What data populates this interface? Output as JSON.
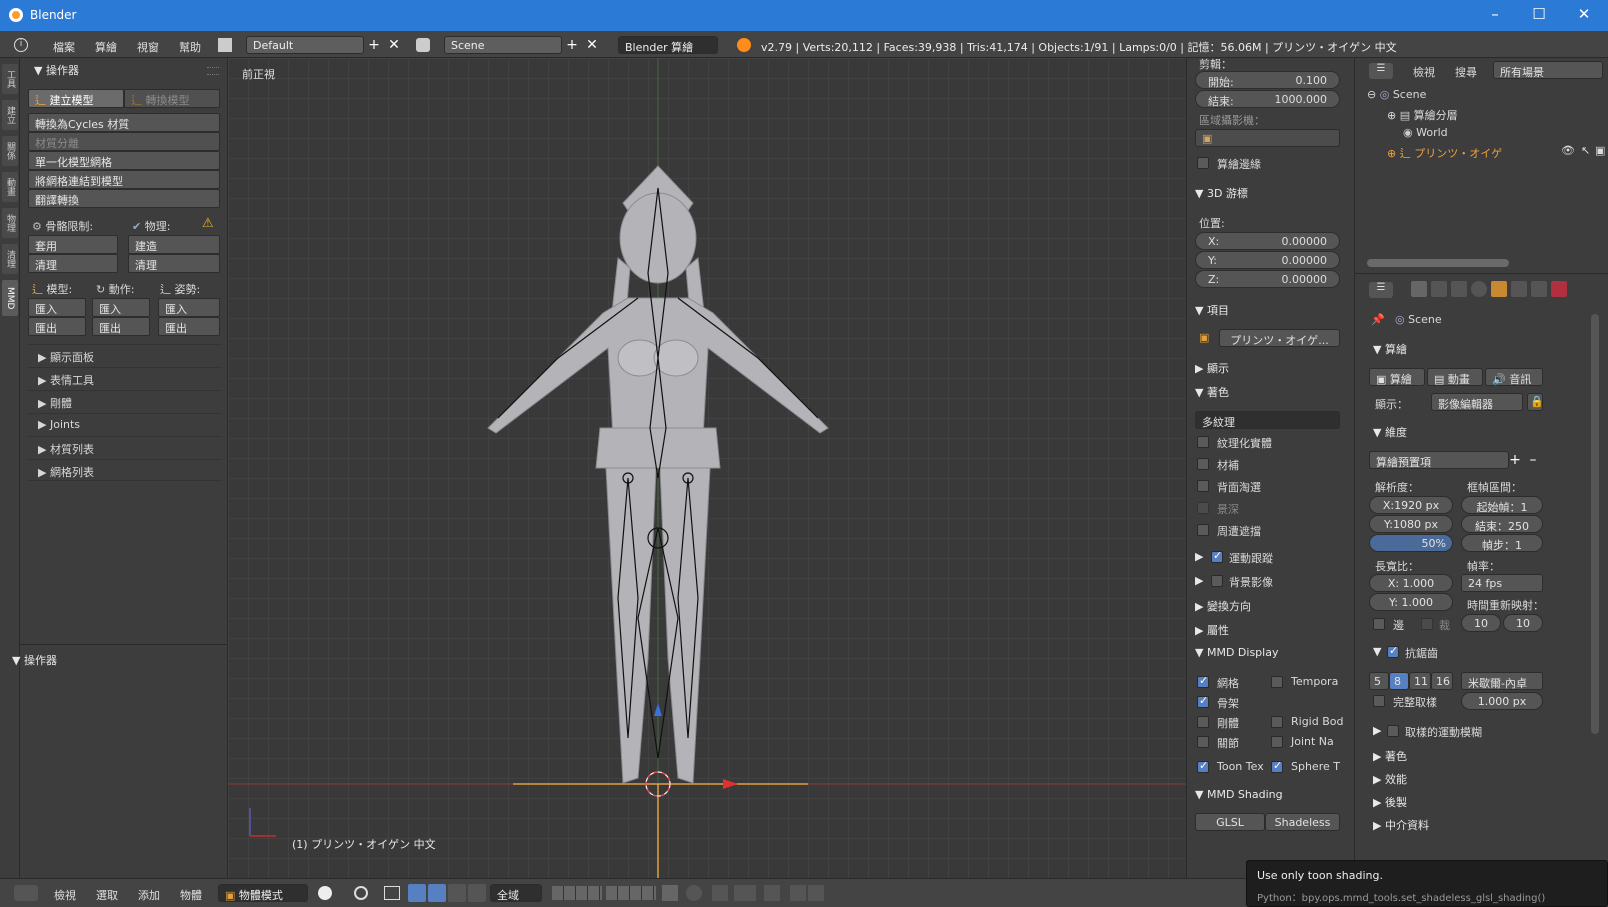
{
  "window": {
    "title": "Blender"
  },
  "menubar": {
    "menus": [
      "檔案",
      "算繪",
      "視窗",
      "幫助"
    ],
    "screen_layout": "Default",
    "scene": "Scene",
    "engine": "Blender 算繪",
    "info": "v2.79 | Verts:20,112 | Faces:39,938 | Tris:41,174 | Objects:1/91 | Lamps:0/0 | 記憶：56.06M | プリンツ・オイゲン 中文"
  },
  "vtabs": [
    "工具",
    "建立",
    "關係",
    "動畫",
    "物理",
    "清理",
    "MMD"
  ],
  "toolshelf": {
    "header": "操作器",
    "tab_create": "建立模型",
    "tab_convert": "轉換模型",
    "buttons": [
      "轉換為Cycles 材質",
      "材質分離",
      "單一化模型網格",
      "將網格連結到模型",
      "翻譯轉換"
    ],
    "bone_label": "骨骼限制:",
    "physics_label": "物理:",
    "apply": "套用",
    "build": "建造",
    "clear": "清理",
    "model_label": "模型:",
    "action_label": "動作:",
    "pose_label": "姿勢:",
    "import": "匯入",
    "export": "匯出",
    "panels": [
      "顯示面板",
      "表情工具",
      "剛體",
      "Joints",
      "材質列表",
      "網格列表"
    ],
    "operator_panel": "操作器"
  },
  "viewport": {
    "view_label": "前正視",
    "object_label": "(1) プリンツ・オイゲン 中文"
  },
  "npanel": {
    "clip_header": "剪輯：",
    "start_label": "開始:",
    "start_value": "0.100",
    "end_label": "結束:",
    "end_value": "1000.000",
    "local_camera": "區域攝影機：",
    "render_border": "算繪邊緣",
    "cursor_header": "3D 游標",
    "location": "位置:",
    "x_label": "X:",
    "x_value": "0.00000",
    "y_label": "Y:",
    "y_value": "0.00000",
    "z_label": "Z:",
    "z_value": "0.00000",
    "item_header": "項目",
    "item_name": "プリンツ・オイゲ...",
    "display_header": "顯示",
    "shading_header": "著色",
    "shading_mode": "多紋理",
    "shade_opts": [
      "紋理化實體",
      "材補",
      "背面淘選",
      "景深",
      "周遭遮擋"
    ],
    "motion_tracking": "運動跟蹤",
    "background_images": "背景影像",
    "transform_orient": "變換方向",
    "properties": "屬性",
    "mmd_display": "MMD Display",
    "mmd_left": [
      "網格",
      "骨架",
      "剛體",
      "關節"
    ],
    "mmd_right": [
      "Tempora",
      "Rigid Bod",
      "Joint Na"
    ],
    "toon_tex": "Toon Tex",
    "sphere_t": "Sphere T",
    "mmd_shading": "MMD Shading",
    "glsl": "GLSL",
    "shadeless": "Shadeless"
  },
  "outliner": {
    "view": "檢視",
    "search": "搜尋",
    "all_scenes": "所有場景",
    "items": [
      "Scene",
      "算繪分層",
      "World",
      "プリンツ・オイゲ"
    ]
  },
  "properties": {
    "scene": "Scene",
    "render_header": "算繪",
    "render_btn": "算繪",
    "anim_btn": "動畫",
    "audio_btn": "音訊",
    "display_label": "顯示：",
    "display_value": "影像編輯器",
    "dimensions_header": "維度",
    "presets": "算繪預置項",
    "resolution_label": "解析度：",
    "frame_range_label": "框幀區間：",
    "res_x": "X:1920 px",
    "res_y": "Y:1080 px",
    "res_pct": "50%",
    "start_frame": "起始幀：1",
    "end_frame": "結束：250",
    "frame_step": "幀步：1",
    "aspect_label": "長寬比：",
    "fps_label": "幀率：",
    "aspect_x": "X: 1.000",
    "aspect_y": "Y: 1.000",
    "fps": "24 fps",
    "time_remap": "時間重新映射：",
    "border": "邊",
    "crop": "裁",
    "remap_old": "10",
    "remap_new": "10",
    "aa_header": "抗鋸齒",
    "aa_samples": [
      "5",
      "8",
      "11",
      "16"
    ],
    "aa_filter": "米歇爾-內卓",
    "full_sample": "完整取樣",
    "filter_size": "1.000 px",
    "sampled_motion_blur": "取樣的運動模糊",
    "panels": [
      "著色",
      "效能",
      "後製",
      "中介資料"
    ]
  },
  "bottombar": {
    "menus": [
      "檢視",
      "選取",
      "添加",
      "物體"
    ],
    "mode": "物體模式",
    "pivot": "全域"
  },
  "tooltip": {
    "text": "Use only toon shading.",
    "python": "Python：bpy.ops.mmd_tools.set_shadeless_glsl_shading()"
  },
  "colors": {
    "titlebar": "#2b7bd6",
    "accent": "#5680c2",
    "background": "#3a3a3a"
  }
}
